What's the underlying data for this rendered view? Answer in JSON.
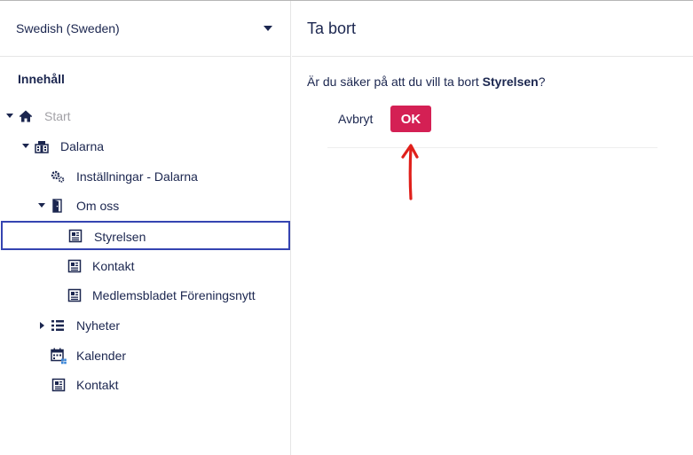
{
  "language": {
    "selected": "Swedish (Sweden)"
  },
  "sidebar": {
    "section_title": "Innehåll",
    "tree": [
      {
        "label": "Start",
        "icon": "home-icon"
      },
      {
        "label": "Dalarna",
        "icon": "building-icon"
      },
      {
        "label": "Inställningar - Dalarna",
        "icon": "gears-icon"
      },
      {
        "label": "Om oss",
        "icon": "door-icon"
      },
      {
        "label": "Styrelsen",
        "icon": "document-icon"
      },
      {
        "label": "Kontakt",
        "icon": "document-icon"
      },
      {
        "label": "Medlemsbladet Föreningsnytt",
        "icon": "document-icon"
      },
      {
        "label": "Nyheter",
        "icon": "list-icon"
      },
      {
        "label": "Kalender",
        "icon": "calendar-icon"
      },
      {
        "label": "Kontakt",
        "icon": "document-icon"
      }
    ]
  },
  "dialog": {
    "title": "Ta bort",
    "question_prefix": "Är du säker på att du vill ta bort ",
    "item_name": "Styrelsen",
    "question_suffix": "?",
    "cancel_label": "Avbryt",
    "ok_label": "OK"
  },
  "colors": {
    "accent": "#d42054",
    "selection_border": "#3544b1",
    "text": "#1b264f",
    "annotation_arrow": "#e0201b"
  }
}
